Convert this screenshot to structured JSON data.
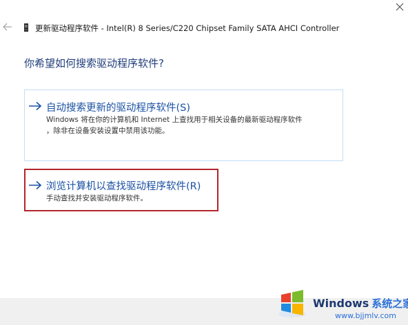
{
  "window": {
    "title": "更新驱动程序软件 - Intel(R) 8 Series/C220 Chipset Family SATA AHCI Controller"
  },
  "question": "你希望如何搜索驱动程序软件?",
  "options": [
    {
      "title": "自动搜索更新的驱动程序软件(S)",
      "desc_line1": "Windows 将在你的计算机和 Internet 上查找用于相关设备的最新驱动程序软件",
      "desc_line2": "，除非在设备安装设置中禁用该功能。"
    },
    {
      "title": "浏览计算机以查找驱动程序软件(R)",
      "desc_line1": "手动查找并安装驱动程序软件。"
    }
  ],
  "watermark": {
    "brand": "Windows",
    "brand_suffix": "系统之家",
    "url": "www.bjjmlv.com"
  },
  "colors": {
    "link_blue": "#1a51a3",
    "heading_blue": "#1f3d7a",
    "highlight_red": "#b1252b",
    "option_border": "#c3ddf5"
  }
}
